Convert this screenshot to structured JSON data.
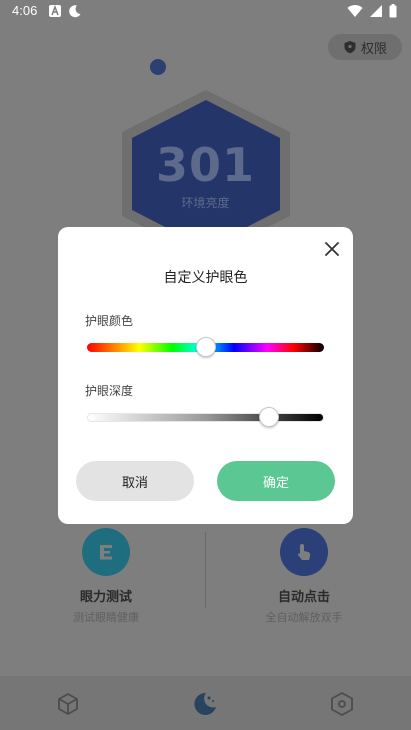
{
  "status_bar": {
    "time": "4:06",
    "left_icons": [
      "notification-a-icon",
      "moon-icon"
    ],
    "right_icons": [
      "wifi-icon",
      "signal-icon",
      "battery-icon"
    ]
  },
  "background": {
    "permission_label": "权限",
    "brightness_value": "301",
    "brightness_label": "环境亮度",
    "features": [
      {
        "title": "眼力测试",
        "subtitle": "测试眼睛健康",
        "icon": "eye-test-icon",
        "color": "#1e6e80"
      },
      {
        "title": "自动点击",
        "subtitle": "全自动解放双手",
        "icon": "tap-hand-icon",
        "color": "#2b3f78"
      }
    ],
    "nav": [
      {
        "icon": "cube-icon"
      },
      {
        "icon": "moon-eye-icon",
        "active": true
      },
      {
        "icon": "hexagon-icon"
      }
    ]
  },
  "dialog": {
    "title": "自定义护眼色",
    "color_label": "护眼颜色",
    "color_value": 0.5,
    "depth_label": "护眼深度",
    "depth_value": 0.77,
    "cancel_label": "取消",
    "ok_label": "确定",
    "ok_color": "#5bc894"
  }
}
